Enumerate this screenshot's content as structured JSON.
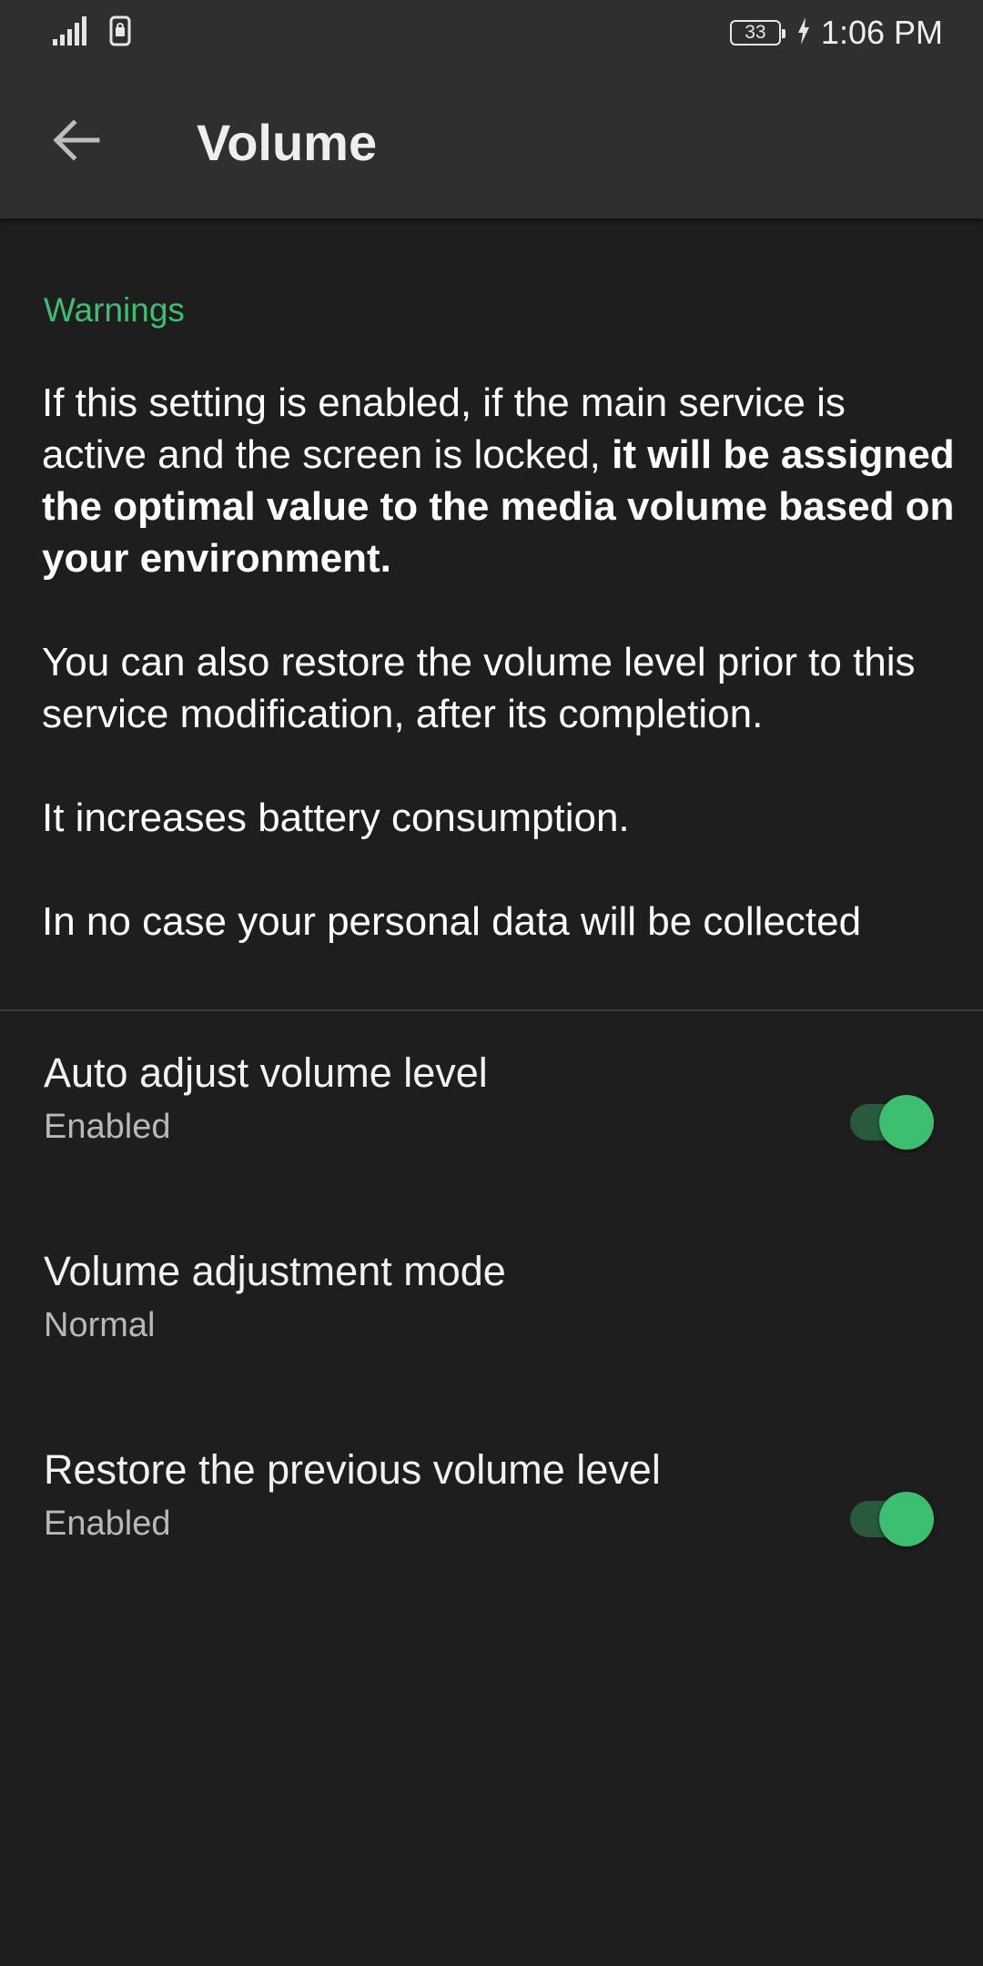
{
  "status_bar": {
    "battery": "33",
    "time": "1:06 PM",
    "icons": [
      "signal-icon",
      "sim-icon",
      "charging-icon"
    ]
  },
  "app_bar": {
    "title": "Volume",
    "back_icon": "arrow-back-icon"
  },
  "warnings": {
    "header": "Warnings",
    "p1_normal": "If this setting is enabled, if the main service is active and the screen is locked, ",
    "p1_bold": "it will be assigned the optimal value to the media volume based on your environment.",
    "p2": "You can also restore the volume level prior to this service modification, after its completion.",
    "p3": "It increases battery consumption.",
    "p4": "In no case your personal data will be collected"
  },
  "preferences": [
    {
      "title": "Auto adjust volume level",
      "summary": "Enabled",
      "switch_on": true
    },
    {
      "title": "Volume adjustment mode",
      "summary": "Normal"
    },
    {
      "title": "Restore the previous volume level",
      "summary": "Enabled",
      "switch_on": true
    }
  ],
  "colors": {
    "background": "#1e1e1e",
    "bar": "#2f2f2f",
    "accent": "#3dbf72",
    "track": "#2a5a3d"
  }
}
